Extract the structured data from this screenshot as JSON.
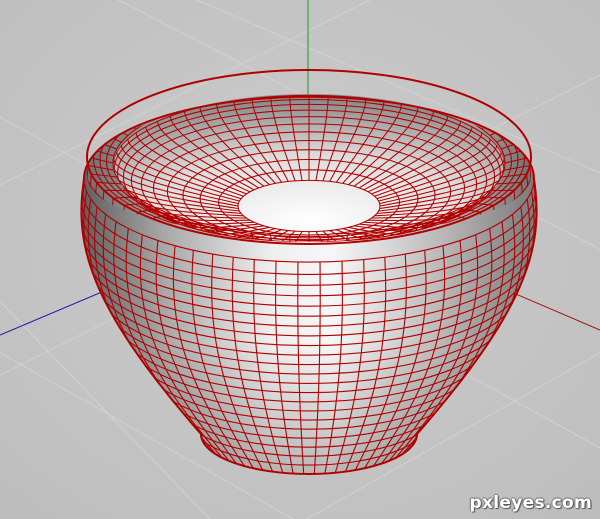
{
  "viewport": {
    "background": "#c4c4c4",
    "grid_color": "#d2d2d2",
    "axes": {
      "x_color": "#a01010",
      "y_color": "#1f9a1f",
      "z_color": "#1a1aa0"
    },
    "model": {
      "kind": "bowl-mesh",
      "wire_color": "#b00000",
      "surface_light": "#f4f4f4",
      "surface_dark": "#8a8a8a"
    }
  },
  "watermark": "pxleyes.com"
}
